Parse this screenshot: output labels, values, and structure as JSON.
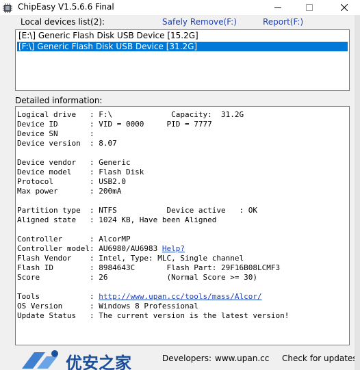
{
  "window": {
    "title": "ChipEasy V1.5.6.6 Final"
  },
  "menu": {
    "devices_label": "Local devices list(2):",
    "safely_remove": "Safely Remove(F:)",
    "report": "Report(F:)"
  },
  "devices": [
    {
      "label": "[E:\\] Generic Flash Disk USB Device [15.2G]",
      "selected": false
    },
    {
      "label": "[F:\\] Generic Flash Disk USB Device [31.2G]",
      "selected": true
    }
  ],
  "details": {
    "heading": "Detailed information:",
    "lines": [
      "Logical drive   : F:\\             Capacity:  31.2G",
      "Device ID       : VID = 0000     PID = 7777",
      "Device SN       :",
      "Device version  : 8.07",
      "",
      "Device vendor   : Generic",
      "Device model    : Flash Disk",
      "Protocol        : USB2.0",
      "Max power       : 200mA",
      "",
      "Partition type  : NTFS           Device active   : OK",
      "Aligned state   : 1024 KB, Have been Aligned",
      "",
      "Controller      : AlcorMP",
      "Controller model: AU6980/AU6983 ",
      "Flash Vendor    : Intel, Type: MLC, Single channel",
      "Flash ID        : 8984643C       Flash Part: 29F16B08LCMF3",
      "Score           : 26             (Normal Score >= 30)",
      "",
      "Tools           : ",
      "OS Version      : Windows 8 Professional",
      "Update Status   : The current version is the latest version!"
    ],
    "help_link": "Help?",
    "tools_link": "http://www.upan.cc/tools/mass/Alcor/"
  },
  "footer": {
    "logo_text": "优安之家",
    "developers_label": "Developers:",
    "developers_site": "www.upan.cc",
    "check_updates": "Check for updates"
  },
  "colors": {
    "link": "#1a3fc1",
    "selection": "#0078d7",
    "logo": "#1b4f9c",
    "window_bg": "#f0f0f0"
  },
  "icons": [
    "chip-app-icon",
    "minimize-icon",
    "maximize-icon",
    "close-icon",
    "upan-logo-icon"
  ]
}
